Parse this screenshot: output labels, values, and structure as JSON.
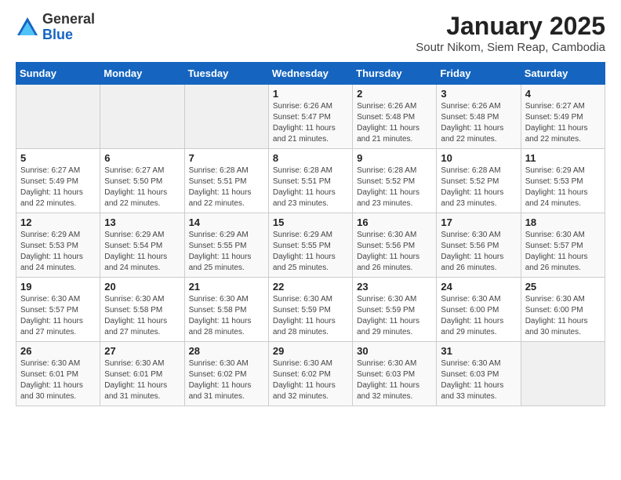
{
  "logo": {
    "general": "General",
    "blue": "Blue"
  },
  "title": "January 2025",
  "location": "Soutr Nikom, Siem Reap, Cambodia",
  "weekdays": [
    "Sunday",
    "Monday",
    "Tuesday",
    "Wednesday",
    "Thursday",
    "Friday",
    "Saturday"
  ],
  "weeks": [
    [
      {
        "day": "",
        "sunrise": "",
        "sunset": "",
        "daylight": ""
      },
      {
        "day": "",
        "sunrise": "",
        "sunset": "",
        "daylight": ""
      },
      {
        "day": "",
        "sunrise": "",
        "sunset": "",
        "daylight": ""
      },
      {
        "day": "1",
        "sunrise": "Sunrise: 6:26 AM",
        "sunset": "Sunset: 5:47 PM",
        "daylight": "Daylight: 11 hours and 21 minutes."
      },
      {
        "day": "2",
        "sunrise": "Sunrise: 6:26 AM",
        "sunset": "Sunset: 5:48 PM",
        "daylight": "Daylight: 11 hours and 21 minutes."
      },
      {
        "day": "3",
        "sunrise": "Sunrise: 6:26 AM",
        "sunset": "Sunset: 5:48 PM",
        "daylight": "Daylight: 11 hours and 22 minutes."
      },
      {
        "day": "4",
        "sunrise": "Sunrise: 6:27 AM",
        "sunset": "Sunset: 5:49 PM",
        "daylight": "Daylight: 11 hours and 22 minutes."
      }
    ],
    [
      {
        "day": "5",
        "sunrise": "Sunrise: 6:27 AM",
        "sunset": "Sunset: 5:49 PM",
        "daylight": "Daylight: 11 hours and 22 minutes."
      },
      {
        "day": "6",
        "sunrise": "Sunrise: 6:27 AM",
        "sunset": "Sunset: 5:50 PM",
        "daylight": "Daylight: 11 hours and 22 minutes."
      },
      {
        "day": "7",
        "sunrise": "Sunrise: 6:28 AM",
        "sunset": "Sunset: 5:51 PM",
        "daylight": "Daylight: 11 hours and 22 minutes."
      },
      {
        "day": "8",
        "sunrise": "Sunrise: 6:28 AM",
        "sunset": "Sunset: 5:51 PM",
        "daylight": "Daylight: 11 hours and 23 minutes."
      },
      {
        "day": "9",
        "sunrise": "Sunrise: 6:28 AM",
        "sunset": "Sunset: 5:52 PM",
        "daylight": "Daylight: 11 hours and 23 minutes."
      },
      {
        "day": "10",
        "sunrise": "Sunrise: 6:28 AM",
        "sunset": "Sunset: 5:52 PM",
        "daylight": "Daylight: 11 hours and 23 minutes."
      },
      {
        "day": "11",
        "sunrise": "Sunrise: 6:29 AM",
        "sunset": "Sunset: 5:53 PM",
        "daylight": "Daylight: 11 hours and 24 minutes."
      }
    ],
    [
      {
        "day": "12",
        "sunrise": "Sunrise: 6:29 AM",
        "sunset": "Sunset: 5:53 PM",
        "daylight": "Daylight: 11 hours and 24 minutes."
      },
      {
        "day": "13",
        "sunrise": "Sunrise: 6:29 AM",
        "sunset": "Sunset: 5:54 PM",
        "daylight": "Daylight: 11 hours and 24 minutes."
      },
      {
        "day": "14",
        "sunrise": "Sunrise: 6:29 AM",
        "sunset": "Sunset: 5:55 PM",
        "daylight": "Daylight: 11 hours and 25 minutes."
      },
      {
        "day": "15",
        "sunrise": "Sunrise: 6:29 AM",
        "sunset": "Sunset: 5:55 PM",
        "daylight": "Daylight: 11 hours and 25 minutes."
      },
      {
        "day": "16",
        "sunrise": "Sunrise: 6:30 AM",
        "sunset": "Sunset: 5:56 PM",
        "daylight": "Daylight: 11 hours and 26 minutes."
      },
      {
        "day": "17",
        "sunrise": "Sunrise: 6:30 AM",
        "sunset": "Sunset: 5:56 PM",
        "daylight": "Daylight: 11 hours and 26 minutes."
      },
      {
        "day": "18",
        "sunrise": "Sunrise: 6:30 AM",
        "sunset": "Sunset: 5:57 PM",
        "daylight": "Daylight: 11 hours and 26 minutes."
      }
    ],
    [
      {
        "day": "19",
        "sunrise": "Sunrise: 6:30 AM",
        "sunset": "Sunset: 5:57 PM",
        "daylight": "Daylight: 11 hours and 27 minutes."
      },
      {
        "day": "20",
        "sunrise": "Sunrise: 6:30 AM",
        "sunset": "Sunset: 5:58 PM",
        "daylight": "Daylight: 11 hours and 27 minutes."
      },
      {
        "day": "21",
        "sunrise": "Sunrise: 6:30 AM",
        "sunset": "Sunset: 5:58 PM",
        "daylight": "Daylight: 11 hours and 28 minutes."
      },
      {
        "day": "22",
        "sunrise": "Sunrise: 6:30 AM",
        "sunset": "Sunset: 5:59 PM",
        "daylight": "Daylight: 11 hours and 28 minutes."
      },
      {
        "day": "23",
        "sunrise": "Sunrise: 6:30 AM",
        "sunset": "Sunset: 5:59 PM",
        "daylight": "Daylight: 11 hours and 29 minutes."
      },
      {
        "day": "24",
        "sunrise": "Sunrise: 6:30 AM",
        "sunset": "Sunset: 6:00 PM",
        "daylight": "Daylight: 11 hours and 29 minutes."
      },
      {
        "day": "25",
        "sunrise": "Sunrise: 6:30 AM",
        "sunset": "Sunset: 6:00 PM",
        "daylight": "Daylight: 11 hours and 30 minutes."
      }
    ],
    [
      {
        "day": "26",
        "sunrise": "Sunrise: 6:30 AM",
        "sunset": "Sunset: 6:01 PM",
        "daylight": "Daylight: 11 hours and 30 minutes."
      },
      {
        "day": "27",
        "sunrise": "Sunrise: 6:30 AM",
        "sunset": "Sunset: 6:01 PM",
        "daylight": "Daylight: 11 hours and 31 minutes."
      },
      {
        "day": "28",
        "sunrise": "Sunrise: 6:30 AM",
        "sunset": "Sunset: 6:02 PM",
        "daylight": "Daylight: 11 hours and 31 minutes."
      },
      {
        "day": "29",
        "sunrise": "Sunrise: 6:30 AM",
        "sunset": "Sunset: 6:02 PM",
        "daylight": "Daylight: 11 hours and 32 minutes."
      },
      {
        "day": "30",
        "sunrise": "Sunrise: 6:30 AM",
        "sunset": "Sunset: 6:03 PM",
        "daylight": "Daylight: 11 hours and 32 minutes."
      },
      {
        "day": "31",
        "sunrise": "Sunrise: 6:30 AM",
        "sunset": "Sunset: 6:03 PM",
        "daylight": "Daylight: 11 hours and 33 minutes."
      },
      {
        "day": "",
        "sunrise": "",
        "sunset": "",
        "daylight": ""
      }
    ]
  ]
}
